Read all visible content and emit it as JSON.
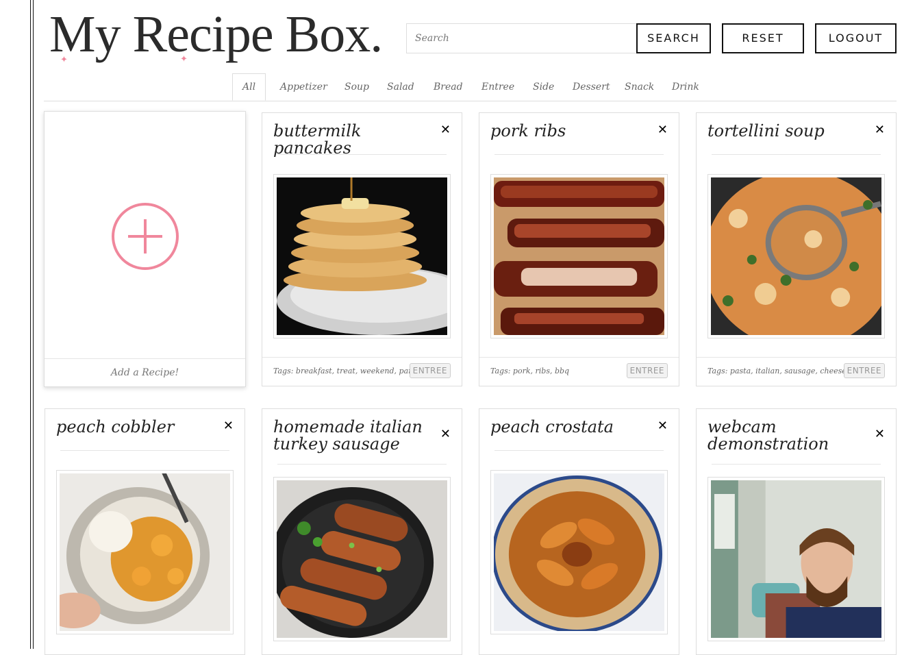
{
  "app": {
    "title": "My Recipe Box."
  },
  "header": {
    "search_placeholder": "Search",
    "search_label": "SEARCH",
    "reset_label": "RESET",
    "logout_label": "LOGOUT"
  },
  "tabs": [
    "All",
    "Appetizer",
    "Soup",
    "Salad",
    "Bread",
    "Entree",
    "Side",
    "Dessert",
    "Snack",
    "Drink"
  ],
  "active_tab": "All",
  "add_card": {
    "label": "Add a Recipe!"
  },
  "recipes": [
    {
      "title": "buttermilk pancakes",
      "tags": "Tags: breakfast, treat, weekend, pancake",
      "category": "ENTREE"
    },
    {
      "title": "pork ribs",
      "tags": "Tags: pork, ribs, bbq",
      "category": "ENTREE"
    },
    {
      "title": "tortellini soup",
      "tags": "Tags: pasta, italian, sausage, cheese",
      "category": "ENTREE"
    },
    {
      "title": "peach cobbler"
    },
    {
      "title": "homemade italian turkey sausage"
    },
    {
      "title": "peach crostata"
    },
    {
      "title": "webcam demonstration"
    }
  ],
  "icons": {
    "close": "close-icon",
    "add": "plus-circle-icon"
  },
  "colors": {
    "accent": "#f0879c",
    "text": "#222222",
    "border": "#dddddd"
  }
}
